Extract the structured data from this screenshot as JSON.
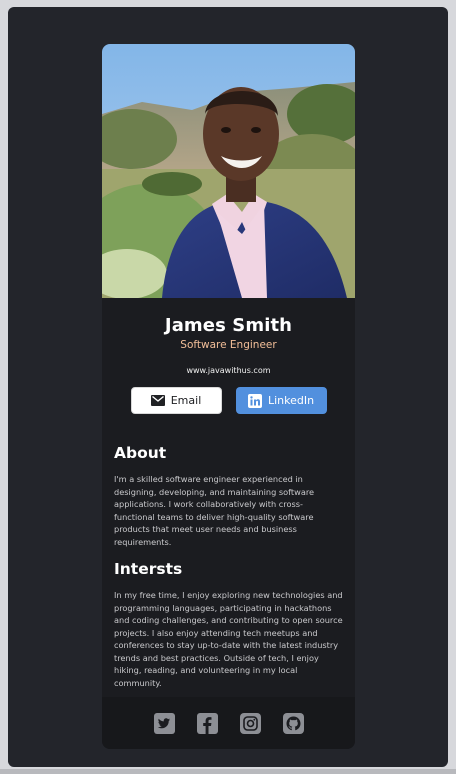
{
  "profile": {
    "name": "James Smith",
    "title": "Software Engineer",
    "website": "www.javawithus.com"
  },
  "buttons": {
    "email_label": "Email",
    "linkedin_label": "LinkedIn"
  },
  "about": {
    "heading": "About",
    "text": "I'm a skilled software engineer experienced in designing, developing, and maintaining software applications. I work collaboratively with cross-functional teams to deliver high-quality software products that meet user needs and business requirements."
  },
  "interests": {
    "heading": "Intersts",
    "text": "In my free time, I enjoy exploring new technologies and programming languages, participating in hackathons and coding challenges, and contributing to open source projects. I also enjoy attending tech meetups and conferences to stay up-to-date with the latest industry trends and best practices. Outside of tech, I enjoy hiking, reading, and volunteering in my local community."
  },
  "footer": {
    "icons": [
      "twitter-icon",
      "facebook-icon",
      "instagram-icon",
      "github-icon"
    ]
  },
  "colors": {
    "background": "#23252b",
    "card": "#1b1c20",
    "accent_title": "#f3bf99",
    "linkedin": "#5290de"
  }
}
